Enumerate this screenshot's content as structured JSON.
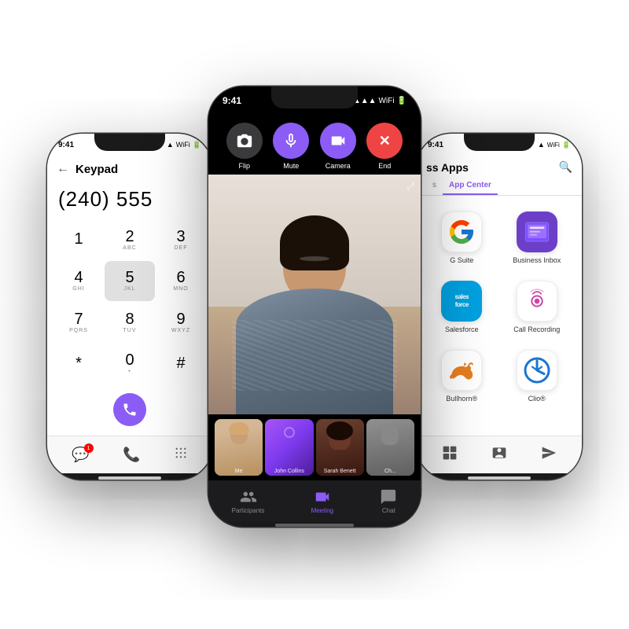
{
  "scene": {
    "bg": "#ffffff"
  },
  "phone_left": {
    "status_time": "9:41",
    "status_icons": "▲ ▲ ▲",
    "header_back": "←",
    "header_title": "Keypad",
    "dial_number": "(240) 555",
    "keys": [
      {
        "main": "1",
        "sub": ""
      },
      {
        "main": "2",
        "sub": "ABC"
      },
      {
        "main": "3",
        "sub": "DEF"
      },
      {
        "main": "4",
        "sub": "GHI"
      },
      {
        "main": "5",
        "sub": "JKL"
      },
      {
        "main": "6",
        "sub": "MNO"
      },
      {
        "main": "7",
        "sub": "PQRS"
      },
      {
        "main": "8",
        "sub": "TUV"
      },
      {
        "main": "9",
        "sub": "WXYZ"
      },
      {
        "main": "*",
        "sub": ""
      },
      {
        "main": "0",
        "sub": "+"
      },
      {
        "main": "#",
        "sub": ""
      }
    ],
    "bottom_icons": [
      "💬",
      "📞",
      "⠿"
    ]
  },
  "phone_center": {
    "status_time": "9:41",
    "controls": [
      {
        "label": "Flip",
        "icon": "⟳",
        "color": "ctrl-gray"
      },
      {
        "label": "Mute",
        "icon": "🎤",
        "color": "ctrl-purple"
      },
      {
        "label": "Camera",
        "icon": "📷",
        "color": "ctrl-purple"
      },
      {
        "label": "End",
        "icon": "✕",
        "color": "ctrl-end"
      }
    ],
    "thumbnails": [
      {
        "label": "Me",
        "class": "thumb-1"
      },
      {
        "label": "John Collins",
        "class": "thumb-2"
      },
      {
        "label": "Sarah Benett",
        "class": "thumb-3"
      },
      {
        "label": "Ch...",
        "class": "thumb-4"
      }
    ],
    "nav": [
      {
        "label": "Participants",
        "icon": "👥",
        "active": false
      },
      {
        "label": "Meeting",
        "icon": "📹",
        "active": true
      },
      {
        "label": "Chat",
        "icon": "💬",
        "active": false
      }
    ]
  },
  "phone_right": {
    "status_time": "9:41",
    "header_title": "ss Apps",
    "search_icon": "🔍",
    "tabs": [
      {
        "label": "s",
        "active": false
      },
      {
        "label": "App Center",
        "active": true
      }
    ],
    "apps": [
      {
        "name": "G Suite",
        "icon_type": "gsuite"
      },
      {
        "name": "Business Inbox",
        "icon_type": "binbox"
      },
      {
        "name": "Salesforce",
        "icon_type": "salesforce"
      },
      {
        "name": "Call Recording",
        "icon_type": "callrec"
      },
      {
        "name": "Bullhorn®",
        "icon_type": "bullhorn"
      },
      {
        "name": "Clio®",
        "icon_type": "clio"
      }
    ],
    "bottom_icons": [
      "⠿⠿",
      "👤",
      "✈"
    ]
  }
}
